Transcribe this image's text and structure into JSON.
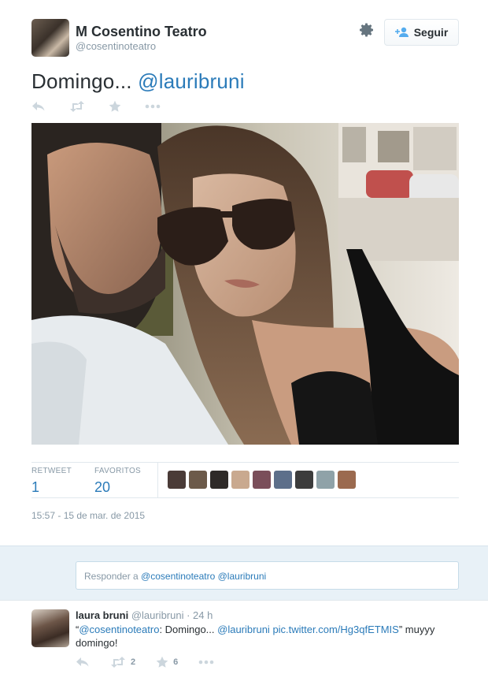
{
  "tweet": {
    "author_name": "M Cosentino Teatro",
    "author_handle": "@cosentinoteatro",
    "follow_label": "Seguir",
    "text_prefix": "Domingo... ",
    "text_mention": "@lauribruni",
    "photo_alt": "selfie photo",
    "stats": {
      "retweets_label": "RETWEET",
      "retweets_count": "1",
      "favorites_label": "FAVORITOS",
      "favorites_count": "20"
    },
    "timestamp": "15:57 - 15 de mar. de 2015"
  },
  "favoriters": [
    {
      "color": "#4a3b37"
    },
    {
      "color": "#6c5a4a"
    },
    {
      "color": "#2e2a28"
    },
    {
      "color": "#c9a98f"
    },
    {
      "color": "#7a4e5a"
    },
    {
      "color": "#5d6f8a"
    },
    {
      "color": "#3c3c3c"
    },
    {
      "color": "#8fa2a8"
    },
    {
      "color": "#9b6a4f"
    }
  ],
  "reply_box": {
    "prefix": "Responder a ",
    "mentions": "@cosentinoteatro @lauribruni"
  },
  "reply": {
    "name": "laura bruni",
    "handle": "@lauribruni",
    "time": "· 24 h",
    "quote_open": "“",
    "mention1": "@cosentinoteatro",
    "text1": ": Domingo... ",
    "mention2": "@lauribruni",
    "link": "pic.twitter.com/Hg3qfETMIS",
    "text2": "” muyyy domingo!",
    "retweet_count": "2",
    "favorite_count": "6"
  },
  "icons": {
    "reply": "reply-icon",
    "retweet": "retweet-icon",
    "favorite": "star-icon",
    "more": "more-icon",
    "settings": "gear-icon",
    "follow": "add-user-icon"
  }
}
